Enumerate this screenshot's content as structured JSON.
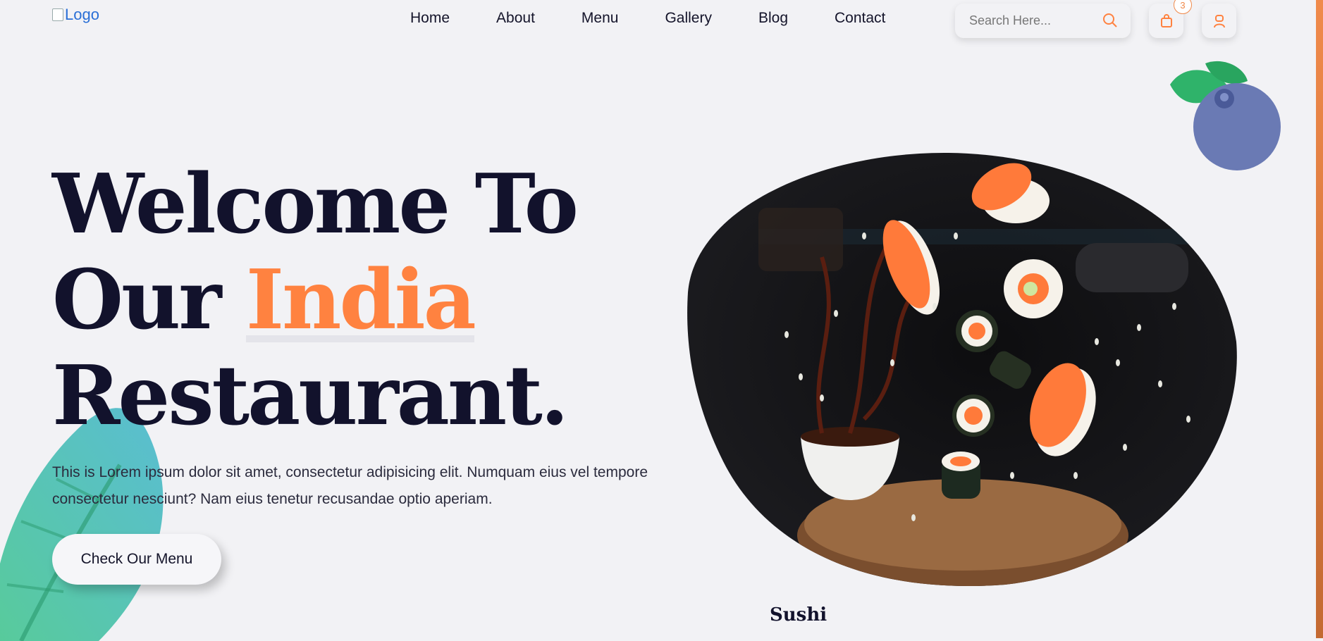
{
  "header": {
    "logo_alt": "Logo",
    "nav": [
      {
        "label": "Home"
      },
      {
        "label": "About"
      },
      {
        "label": "Menu"
      },
      {
        "label": "Gallery"
      },
      {
        "label": "Blog"
      },
      {
        "label": "Contact"
      }
    ],
    "search": {
      "placeholder": "Search Here...",
      "icon": "search-icon"
    },
    "cart": {
      "icon": "shopping-bag-icon",
      "count": "3"
    },
    "user": {
      "icon": "user-icon"
    }
  },
  "hero": {
    "title_line1": "Welcome To",
    "title_line2_prefix": "Our ",
    "title_line2_accent": "India",
    "title_line3": "Restaurant.",
    "description": "This is Lorem ipsum dolor sit amet, consectetur adipisicing elit. Numquam eius vel tempore consectetur nesciunt? Nam eius tenetur recusandae optio aperiam.",
    "cta_label": "Check Our Menu",
    "dish_caption": "Sushi"
  },
  "colors": {
    "accent": "#ff8240",
    "dark_text": "#12122c",
    "background": "#f2f2f5"
  }
}
